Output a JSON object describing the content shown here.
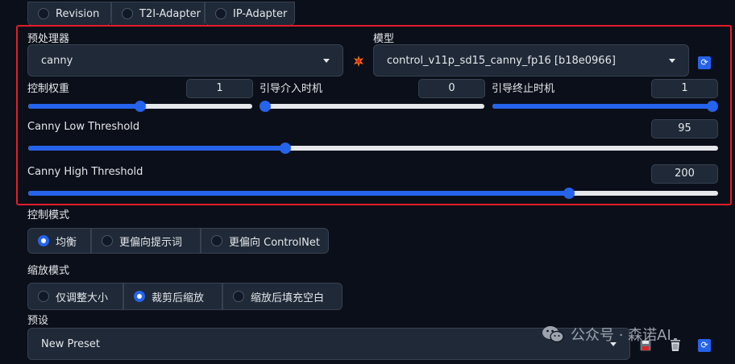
{
  "top_radios": [
    {
      "label": "Revision",
      "checked": false
    },
    {
      "label": "T2I-Adapter",
      "checked": false
    },
    {
      "label": "IP-Adapter",
      "checked": false
    }
  ],
  "preprocessor": {
    "label": "预处理器",
    "value": "canny"
  },
  "model": {
    "label": "模型",
    "value": "control_v11p_sd15_canny_fp16 [b18e0966]"
  },
  "sliders": {
    "control_weight": {
      "label": "控制权重",
      "value": "1",
      "fraction": 0.5
    },
    "guidance_start": {
      "label": "引导介入时机",
      "value": "0",
      "fraction": 0.0
    },
    "guidance_end": {
      "label": "引导终止时机",
      "value": "1",
      "fraction": 1.0
    },
    "canny_low": {
      "label": "Canny Low Threshold",
      "value": "95",
      "fraction": 0.373
    },
    "canny_high": {
      "label": "Canny High Threshold",
      "value": "200",
      "fraction": 0.784
    }
  },
  "control_mode": {
    "label": "控制模式",
    "options": [
      {
        "label": "均衡",
        "checked": true
      },
      {
        "label": "更偏向提示词",
        "checked": false
      },
      {
        "label": "更偏向 ControlNet",
        "checked": false
      }
    ]
  },
  "resize_mode": {
    "label": "缩放模式",
    "options": [
      {
        "label": "仅调整大小",
        "checked": false
      },
      {
        "label": "裁剪后缩放",
        "checked": true
      },
      {
        "label": "缩放后填充空白",
        "checked": false
      }
    ]
  },
  "preset": {
    "label": "预设",
    "value": "New Preset"
  },
  "watermark": {
    "text": "公众号 · 森诺AI"
  },
  "colors": {
    "accent": "#2563eb",
    "highlight": "#e11d2a",
    "background": "#0b0f19"
  }
}
